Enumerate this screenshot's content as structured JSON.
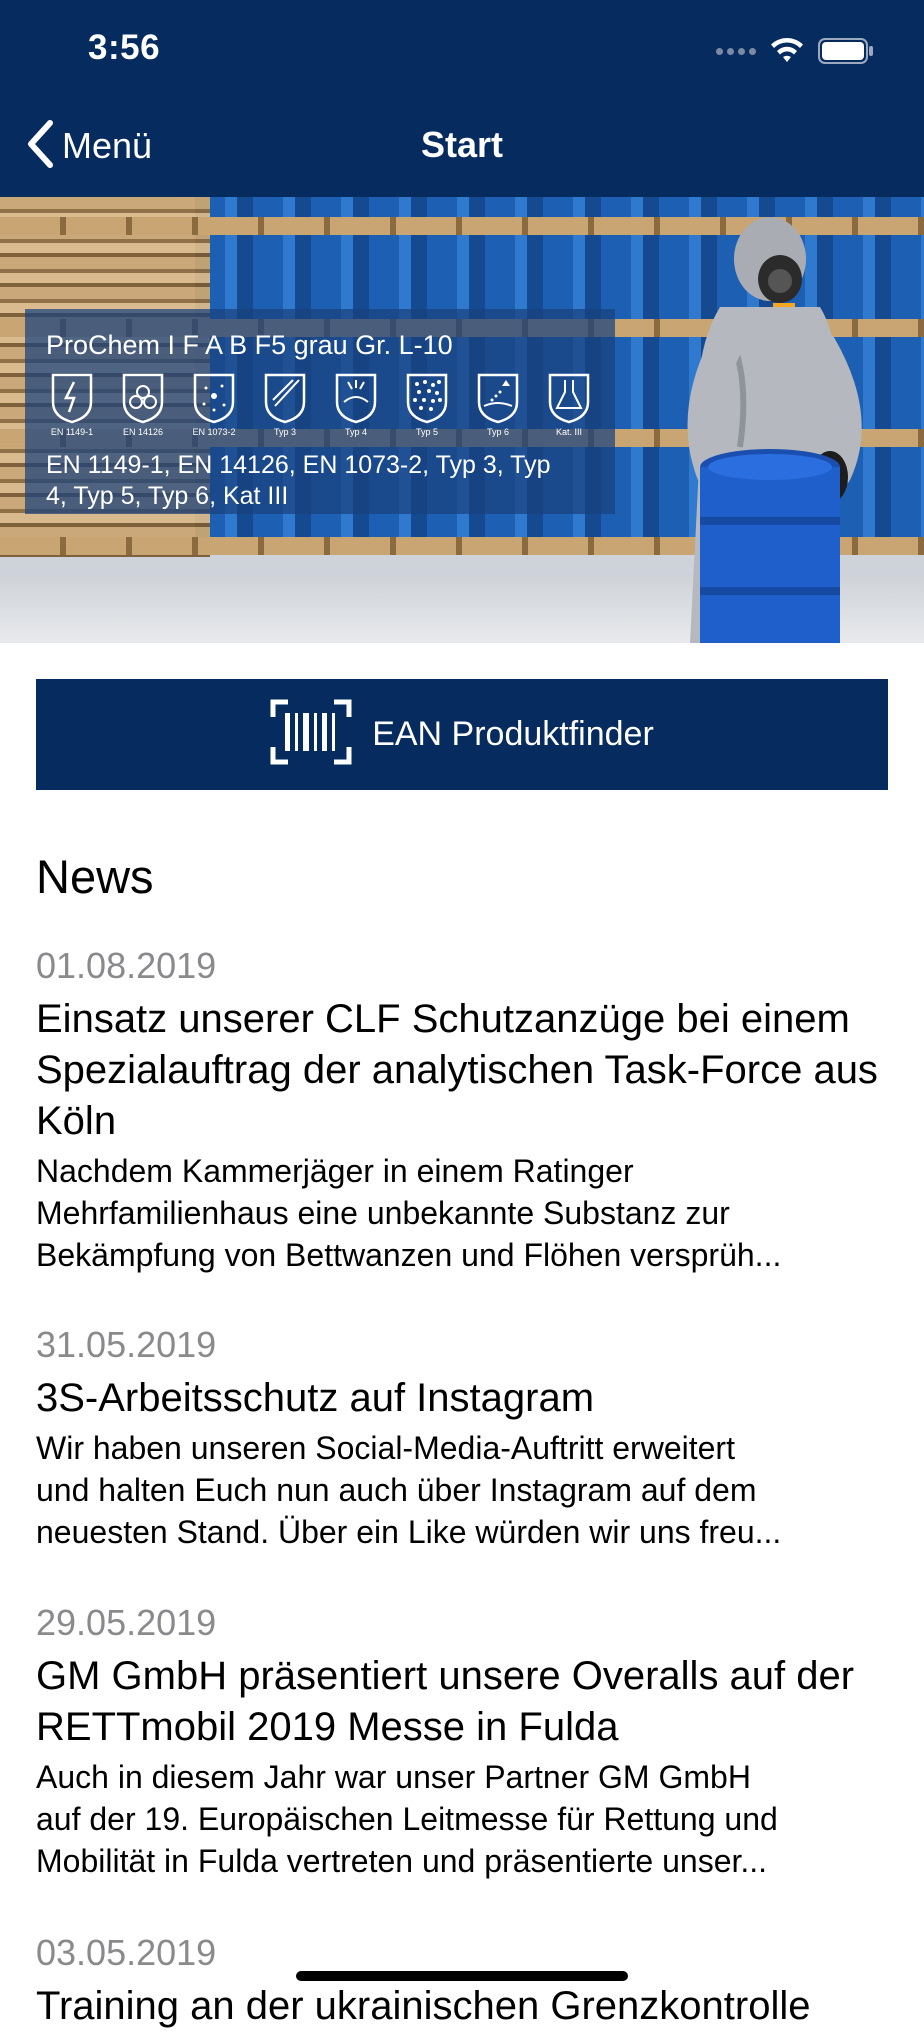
{
  "status_bar": {
    "time": "3:56"
  },
  "nav": {
    "back_label": "Menü",
    "title": "Start"
  },
  "hero": {
    "product_name": "ProChem I F A B F5 grau Gr. L-10",
    "certifications": [
      {
        "label": "EN 1149-1",
        "icon": "antistatic-icon"
      },
      {
        "label": "EN 14126",
        "icon": "biohazard-icon"
      },
      {
        "label": "EN 1073-2",
        "icon": "radioactive-particles-icon"
      },
      {
        "label": "Typ 3",
        "icon": "liquid-jet-icon"
      },
      {
        "label": "Typ 4",
        "icon": "spray-icon"
      },
      {
        "label": "Typ 5",
        "icon": "particles-icon"
      },
      {
        "label": "Typ 6",
        "icon": "light-spray-icon"
      },
      {
        "label": "Kat. III",
        "icon": "chemical-flask-icon"
      }
    ],
    "norms_line1": "EN 1149-1, EN 14126, EN 1073-2, Typ 3, Typ",
    "norms_line2": "4, Typ 5, Typ 6, Kat III"
  },
  "ean_button": {
    "label": "EAN Produktfinder",
    "icon": "barcode-scan-icon"
  },
  "news": {
    "heading": "News",
    "items": [
      {
        "date": "01.08.2019",
        "title_lines": [
          "Einsatz unserer CLF Schutzanzüge bei",
          "einem Spezialauftrag der analytischen",
          "Task-Force aus Köln"
        ],
        "body_lines": [
          "Nachdem Kammerjäger in einem Ratinger",
          "Mehrfamilienhaus eine unbekannte Substanz zur",
          "Bekämpfung von Bettwanzen und Flöhen versprüh..."
        ]
      },
      {
        "date": "31.05.2019",
        "title_lines": [
          "3S-Arbeitsschutz auf Instagram"
        ],
        "body_lines": [
          "Wir haben unseren Social-Media-Auftritt erweitert",
          "und halten Euch nun auch über Instagram auf dem",
          "neuesten Stand. Über ein Like würden wir uns freu..."
        ]
      },
      {
        "date": "29.05.2019",
        "title_lines": [
          "GM GmbH präsentiert unsere Overalls auf",
          "der RETTmobil 2019 Messe in Fulda"
        ],
        "body_lines": [
          "Auch in diesem Jahr war unser Partner GM GmbH",
          "auf der 19. Europäischen Leitmesse für Rettung und",
          "Mobilität in Fulda vertreten und präsentierte unser..."
        ]
      },
      {
        "date": "03.05.2019",
        "title_lines": [
          "Training an der ukrainischen Grenzkontrolle"
        ],
        "body_lines": []
      }
    ]
  },
  "colors": {
    "brand_navy": "#062b5f",
    "date_gray": "#8a8a8e"
  }
}
